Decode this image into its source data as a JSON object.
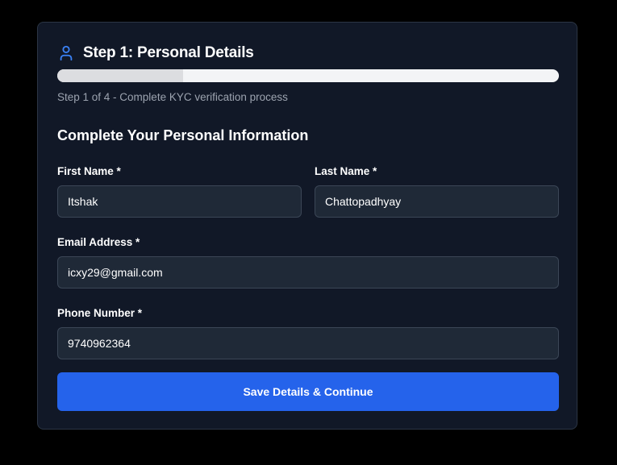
{
  "header": {
    "icon": "user-icon",
    "title": "Step 1: Personal Details",
    "accent_color": "#3b82f6"
  },
  "progress": {
    "current_step": 1,
    "total_steps": 4,
    "fraction": 0.25,
    "text": "Step 1 of 4 - Complete KYC verification process"
  },
  "form": {
    "section_title": "Complete Your Personal Information",
    "first_name": {
      "label": "First Name *",
      "value": "Itshak"
    },
    "last_name": {
      "label": "Last Name *",
      "value": "Chattopadhyay"
    },
    "email": {
      "label": "Email Address *",
      "value": "icxy29@gmail.com"
    },
    "phone": {
      "label": "Phone Number *",
      "value": "9740962364"
    },
    "submit_label": "Save Details & Continue",
    "submit_color": "#2563eb"
  }
}
